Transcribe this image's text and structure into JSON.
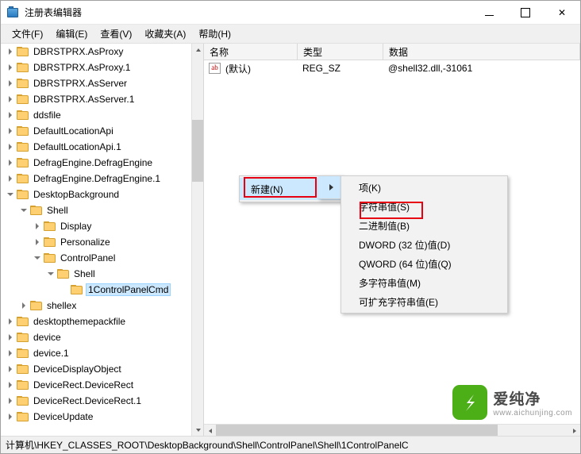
{
  "window": {
    "title": "注册表编辑器",
    "icon": "registry-editor-icon",
    "minimize_label": "",
    "maximize_label": "",
    "close_label": "✕"
  },
  "menubar": [
    {
      "label": "文件(F)",
      "name": "menu-file"
    },
    {
      "label": "编辑(E)",
      "name": "menu-edit"
    },
    {
      "label": "查看(V)",
      "name": "menu-view"
    },
    {
      "label": "收藏夹(A)",
      "name": "menu-favorites"
    },
    {
      "label": "帮助(H)",
      "name": "menu-help"
    }
  ],
  "tree": [
    {
      "label": "DBRSTPRX.AsProxy",
      "indent": 0,
      "twisty": "right",
      "selected": false
    },
    {
      "label": "DBRSTPRX.AsProxy.1",
      "indent": 0,
      "twisty": "right",
      "selected": false
    },
    {
      "label": "DBRSTPRX.AsServer",
      "indent": 0,
      "twisty": "right",
      "selected": false
    },
    {
      "label": "DBRSTPRX.AsServer.1",
      "indent": 0,
      "twisty": "right",
      "selected": false
    },
    {
      "label": "ddsfile",
      "indent": 0,
      "twisty": "right",
      "selected": false
    },
    {
      "label": "DefaultLocationApi",
      "indent": 0,
      "twisty": "right",
      "selected": false
    },
    {
      "label": "DefaultLocationApi.1",
      "indent": 0,
      "twisty": "right",
      "selected": false
    },
    {
      "label": "DefragEngine.DefragEngine",
      "indent": 0,
      "twisty": "right",
      "selected": false
    },
    {
      "label": "DefragEngine.DefragEngine.1",
      "indent": 0,
      "twisty": "right",
      "selected": false
    },
    {
      "label": "DesktopBackground",
      "indent": 0,
      "twisty": "down",
      "selected": false
    },
    {
      "label": "Shell",
      "indent": 1,
      "twisty": "down",
      "selected": false
    },
    {
      "label": "Display",
      "indent": 2,
      "twisty": "right",
      "selected": false
    },
    {
      "label": "Personalize",
      "indent": 2,
      "twisty": "right",
      "selected": false
    },
    {
      "label": "ControlPanel",
      "indent": 2,
      "twisty": "down",
      "selected": false
    },
    {
      "label": "Shell",
      "indent": 3,
      "twisty": "down",
      "selected": false
    },
    {
      "label": "1ControlPanelCmd",
      "indent": 4,
      "twisty": "none",
      "selected": true
    },
    {
      "label": "shellex",
      "indent": 1,
      "twisty": "right",
      "selected": false
    },
    {
      "label": "desktopthemepackfile",
      "indent": 0,
      "twisty": "right",
      "selected": false
    },
    {
      "label": "device",
      "indent": 0,
      "twisty": "right",
      "selected": false
    },
    {
      "label": "device.1",
      "indent": 0,
      "twisty": "right",
      "selected": false
    },
    {
      "label": "DeviceDisplayObject",
      "indent": 0,
      "twisty": "right",
      "selected": false
    },
    {
      "label": "DeviceRect.DeviceRect",
      "indent": 0,
      "twisty": "right",
      "selected": false
    },
    {
      "label": "DeviceRect.DeviceRect.1",
      "indent": 0,
      "twisty": "right",
      "selected": false
    },
    {
      "label": "DeviceUpdate",
      "indent": 0,
      "twisty": "right",
      "selected": false
    }
  ],
  "list": {
    "columns": [
      "名称",
      "类型",
      "数据"
    ],
    "rows": [
      {
        "name": "(默认)",
        "type": "REG_SZ",
        "data": "@shell32.dll,-31061",
        "icon": "ab-string-value-icon"
      }
    ]
  },
  "context_menu_new": {
    "items": [
      {
        "label": "新建(N)",
        "highlighted": true,
        "submenu": true,
        "name": "ctx-new"
      }
    ]
  },
  "context_submenu": {
    "items": [
      {
        "label": "项(K)",
        "name": "ctx-key",
        "highlighted": false
      },
      {
        "label": "字符串值(S)",
        "name": "ctx-string-value",
        "highlighted": false
      },
      {
        "label": "二进制值(B)",
        "name": "ctx-binary-value",
        "highlighted": false
      },
      {
        "label": "DWORD (32 位)值(D)",
        "name": "ctx-dword-value",
        "highlighted": false
      },
      {
        "label": "QWORD (64 位)值(Q)",
        "name": "ctx-qword-value",
        "highlighted": false
      },
      {
        "label": "多字符串值(M)",
        "name": "ctx-multi-string-value",
        "highlighted": false
      },
      {
        "label": "可扩充字符串值(E)",
        "name": "ctx-expandable-string-value",
        "highlighted": false
      }
    ]
  },
  "statusbar": {
    "path": "计算机\\HKEY_CLASSES_ROOT\\DesktopBackground\\Shell\\ControlPanel\\Shell\\1ControlPanelC"
  },
  "watermark": {
    "brand": "爱纯净",
    "url": "www.aichunjing.com",
    "logo_color": "#4caf18"
  },
  "colors": {
    "highlight_blue": "#cce8ff",
    "annotation_red": "#e60012",
    "folder_yellow": "#ffd071"
  }
}
